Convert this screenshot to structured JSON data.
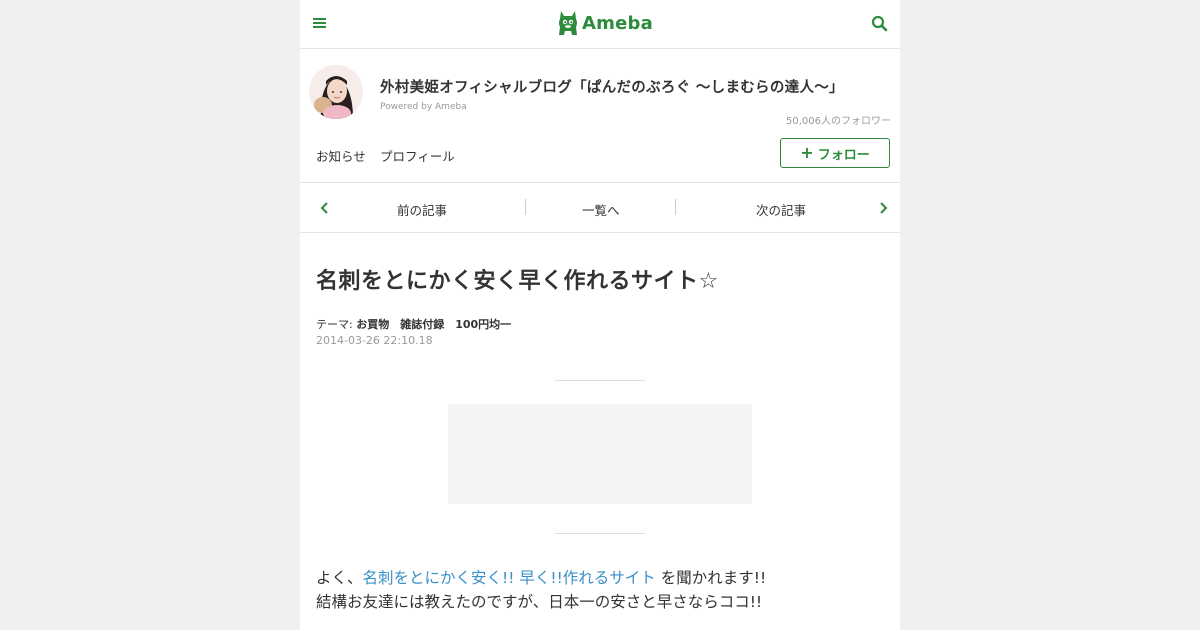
{
  "header": {
    "logo_text": "Ameba",
    "brand_color": "#2d8c3c",
    "menu_icon": "hamburger-icon",
    "search_icon": "search-icon"
  },
  "blog": {
    "title": "外村美姫オフィシャルブログ「ぱんだのぶろぐ ～しまむらの達人～」",
    "powered_by": "Powered by Ameba",
    "followers": "50,006人のフォロワー",
    "nav": [
      "お知らせ",
      "プロフィール"
    ],
    "follow_label": "フォロー"
  },
  "article_nav": {
    "prev": "前の記事",
    "list": "一覧へ",
    "next": "次の記事"
  },
  "article": {
    "title": "名刺をとにかく安く早く作れるサイト☆",
    "theme_label": "テーマ:",
    "themes": "お買物　雑誌付録　100円均一",
    "date": "2014-03-26 22:10.18",
    "line1_prefix": "よく、",
    "line1_link": "名刺をとにかく安く!! 早く!!作れるサイト",
    "line1_suffix": " を聞かれます!!",
    "line2": "結構お友達には教えたのですが、日本一の安さと早さならココ!!",
    "link_color": "#3a8fc8"
  }
}
